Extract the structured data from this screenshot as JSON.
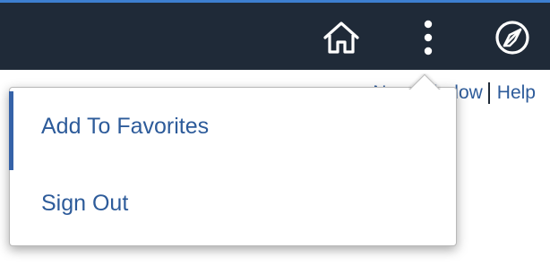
{
  "header": {
    "home_icon": "home-icon",
    "menu_icon": "vertical-ellipsis-icon",
    "navbar_icon": "compass-icon",
    "background_color": "#1f2a38",
    "accent_color": "#3d7fd0"
  },
  "links": {
    "partial_link": "New Window",
    "help_label": "Help"
  },
  "action_menu": {
    "items": [
      {
        "label": "Add To Favorites",
        "active": true
      },
      {
        "label": "Sign Out",
        "active": false
      }
    ],
    "text_color": "#2d5b9a",
    "active_indicator_color": "#3562a8"
  }
}
